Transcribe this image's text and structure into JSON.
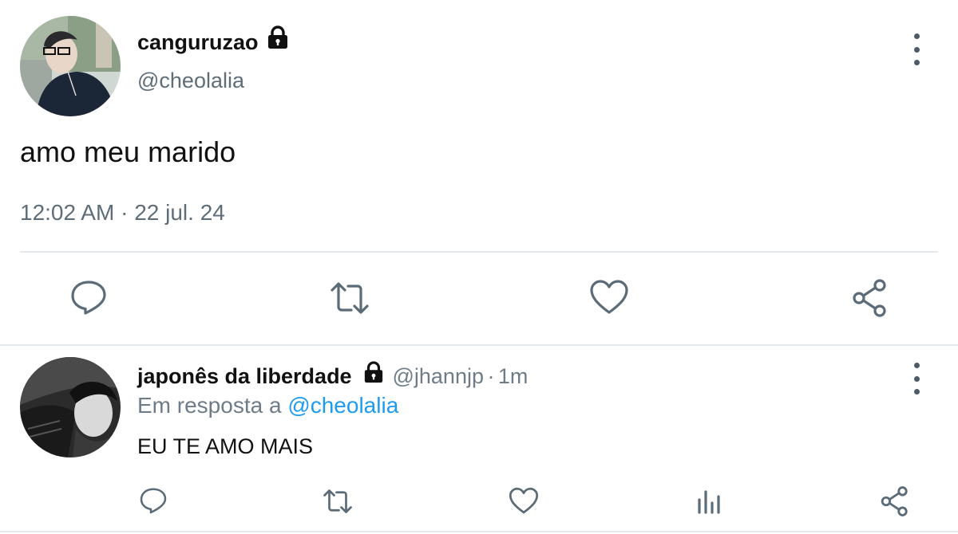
{
  "main_tweet": {
    "display_name": "canguruzao",
    "handle": "@cheolalia",
    "text": "amo meu marido",
    "time": "12:02 AM",
    "separator": "·",
    "date": "22 jul. 24"
  },
  "reply_tweet": {
    "display_name": "japonês da liberdade",
    "handle": "@jhannjp",
    "separator": "·",
    "age": "1m",
    "reply_prefix": "Em resposta a",
    "reply_mention": "@cheolalia",
    "text": "EU TE AMO MAIS"
  },
  "icons": {
    "locked": "lock-icon",
    "menu": "more-vertical-icon",
    "reply": "reply-icon",
    "retweet": "retweet-icon",
    "like": "heart-icon",
    "share": "share-icon",
    "views": "views-icon"
  },
  "colors": {
    "icon_gray": "#5b6b78",
    "mention_blue": "#1d9bf0",
    "divider": "#e6e9eb"
  }
}
